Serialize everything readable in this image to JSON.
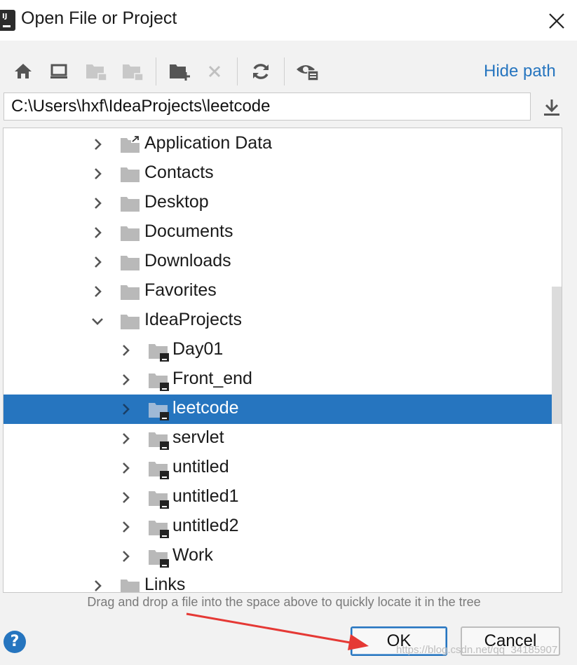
{
  "window": {
    "title": "Open File or Project",
    "app_icon_text": "IJ"
  },
  "toolbar": {
    "buttons": [
      {
        "icon": "home-icon",
        "enabled": true
      },
      {
        "icon": "desktop-icon",
        "enabled": true
      },
      {
        "icon": "project-folder-icon",
        "enabled": false
      },
      {
        "icon": "module-folder-icon",
        "enabled": false
      },
      {
        "icon": "new-folder-icon",
        "enabled": true
      },
      {
        "icon": "delete-icon",
        "enabled": false
      },
      {
        "icon": "refresh-icon",
        "enabled": true
      },
      {
        "icon": "show-hidden-icon",
        "enabled": true
      }
    ],
    "hide_path_label": "Hide path"
  },
  "path": {
    "value": "C:\\Users\\hxf\\IdeaProjects\\leetcode"
  },
  "tree": {
    "rows": [
      {
        "label": "Application Data",
        "level": 0,
        "expanded": false,
        "type": "shortcut",
        "selected": false
      },
      {
        "label": "Contacts",
        "level": 0,
        "expanded": false,
        "type": "folder",
        "selected": false
      },
      {
        "label": "Desktop",
        "level": 0,
        "expanded": false,
        "type": "folder",
        "selected": false
      },
      {
        "label": "Documents",
        "level": 0,
        "expanded": false,
        "type": "folder",
        "selected": false
      },
      {
        "label": "Downloads",
        "level": 0,
        "expanded": false,
        "type": "folder",
        "selected": false
      },
      {
        "label": "Favorites",
        "level": 0,
        "expanded": false,
        "type": "folder",
        "selected": false
      },
      {
        "label": "IdeaProjects",
        "level": 0,
        "expanded": true,
        "type": "folder",
        "selected": false
      },
      {
        "label": "Day01",
        "level": 1,
        "expanded": false,
        "type": "project",
        "selected": false
      },
      {
        "label": "Front_end",
        "level": 1,
        "expanded": false,
        "type": "project",
        "selected": false
      },
      {
        "label": "leetcode",
        "level": 1,
        "expanded": false,
        "type": "project",
        "selected": true
      },
      {
        "label": "servlet",
        "level": 1,
        "expanded": false,
        "type": "project",
        "selected": false
      },
      {
        "label": "untitled",
        "level": 1,
        "expanded": false,
        "type": "project",
        "selected": false
      },
      {
        "label": "untitled1",
        "level": 1,
        "expanded": false,
        "type": "project",
        "selected": false
      },
      {
        "label": "untitled2",
        "level": 1,
        "expanded": false,
        "type": "project",
        "selected": false
      },
      {
        "label": "Work",
        "level": 1,
        "expanded": false,
        "type": "project",
        "selected": false
      },
      {
        "label": "Links",
        "level": 0,
        "expanded": false,
        "type": "folder",
        "selected": false
      }
    ]
  },
  "hint_text": "Drag and drop a file into the space above to quickly locate it in the tree",
  "footer": {
    "help_label": "?",
    "ok_label": "OK",
    "cancel_label": "Cancel"
  },
  "watermark": "https://blog.csdn.net/qq_34185907",
  "colors": {
    "accent": "#2675bf",
    "selection": "#2675bf",
    "annotation_arrow": "#e53935"
  }
}
